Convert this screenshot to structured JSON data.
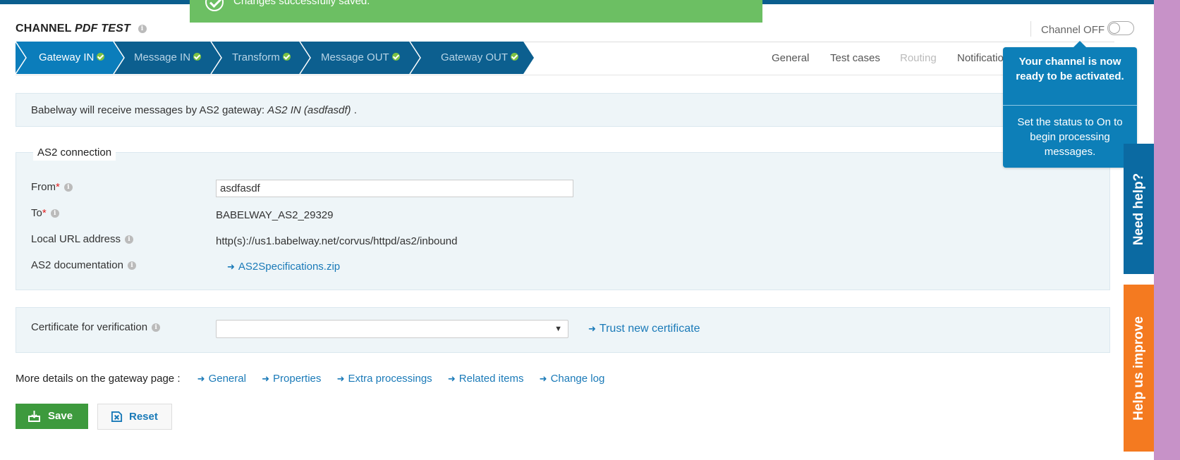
{
  "toast": {
    "message": "Changes successfully saved."
  },
  "header": {
    "title_prefix": "CHANNEL",
    "title_name": "PDF TEST",
    "channel_status": "Channel OFF"
  },
  "steps": [
    "Gateway IN",
    "Message IN",
    "Transform",
    "Message OUT",
    "Gateway OUT"
  ],
  "tabs": {
    "general": "General",
    "test_cases": "Test cases",
    "routing": "Routing",
    "notifications": "Notificatio"
  },
  "popover": {
    "headline": "Your channel is now ready to be activated.",
    "body": "Set the status to On to begin processing messages."
  },
  "intro": {
    "text": "Babelway will receive messages by AS2 gateway:",
    "gateway": "AS2 IN (asdfasdf)",
    "end": "."
  },
  "as2": {
    "legend": "AS2 connection",
    "from_label": "From",
    "from_value": "asdfasdf",
    "to_label": "To",
    "to_value": "BABELWAY_AS2_29329",
    "url_label": "Local URL address",
    "url_value": "http(s)://us1.babelway.net/corvus/httpd/as2/inbound",
    "doc_label": "AS2 documentation",
    "doc_link": "AS2Specifications.zip"
  },
  "cert": {
    "label": "Certificate for verification",
    "trust_link": "Trust new certificate"
  },
  "details": {
    "label": "More details on the gateway page :",
    "links": [
      "General",
      "Properties",
      "Extra processings",
      "Related items",
      "Change log"
    ]
  },
  "buttons": {
    "save": "Save",
    "reset": "Reset"
  },
  "side": {
    "need_help": "Need help?",
    "improve": "Help us improve"
  },
  "colors": {
    "step_active": "#0b7dbb",
    "step_inactive": "#0c5f8f",
    "accent": "#1a7ab8",
    "save": "#3d9a3d",
    "toast": "#6cbf63",
    "improve": "#f47a20"
  }
}
